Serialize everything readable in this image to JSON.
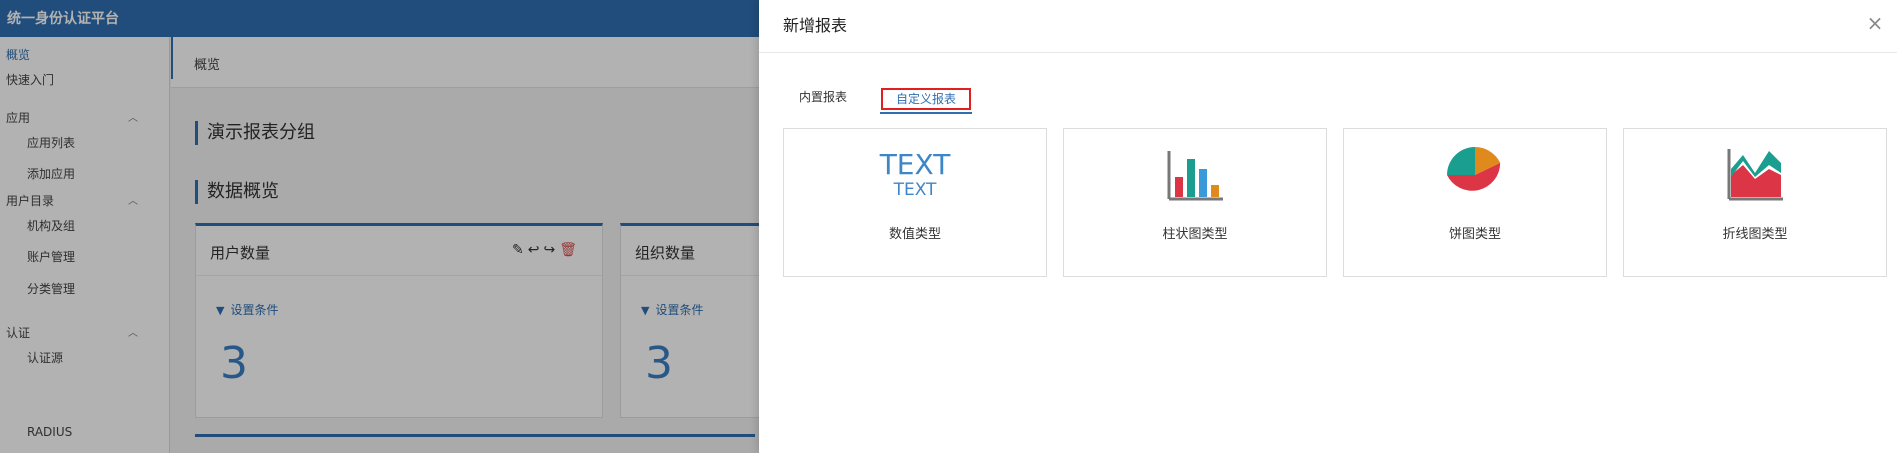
{
  "app": {
    "title": "统一身份认证平台"
  },
  "sidebar": {
    "items": [
      {
        "label": "概览"
      },
      {
        "label": "快速入门"
      }
    ],
    "groups": [
      {
        "label": "应用",
        "children": [
          "应用列表",
          "添加应用"
        ]
      },
      {
        "label": "用户目录",
        "children": [
          "机构及组",
          "账户管理",
          "分类管理"
        ]
      },
      {
        "label": "认证",
        "children": [
          "认证源",
          "RADIUS"
        ]
      }
    ]
  },
  "breadcrumb": {
    "label": "概览"
  },
  "main": {
    "group_title": "演示报表分组",
    "overview_title": "数据概览",
    "cards": [
      {
        "title": "用户数量",
        "filter": "设置条件",
        "value": "3"
      },
      {
        "title": "组织数量",
        "filter": "设置条件",
        "value": "3"
      }
    ]
  },
  "drawer": {
    "title": "新增报表",
    "close": "×",
    "tabs": [
      {
        "label": "内置报表"
      },
      {
        "label": "自定义报表"
      }
    ],
    "types": [
      {
        "label": "数值类型",
        "icon": "text-value-icon",
        "icon_text_big": "TEXT",
        "icon_text_small": "TEXT"
      },
      {
        "label": "柱状图类型",
        "icon": "bar-chart-icon"
      },
      {
        "label": "饼图类型",
        "icon": "pie-chart-icon"
      },
      {
        "label": "折线图类型",
        "icon": "line-chart-icon"
      }
    ]
  },
  "colors": {
    "primary": "#2f6fb1",
    "highlight_border": "#e02020",
    "bar_red": "#dc3545",
    "bar_teal": "#1a9e8f",
    "bar_blue": "#3a9ad9",
    "bar_orange": "#e08a1e"
  }
}
